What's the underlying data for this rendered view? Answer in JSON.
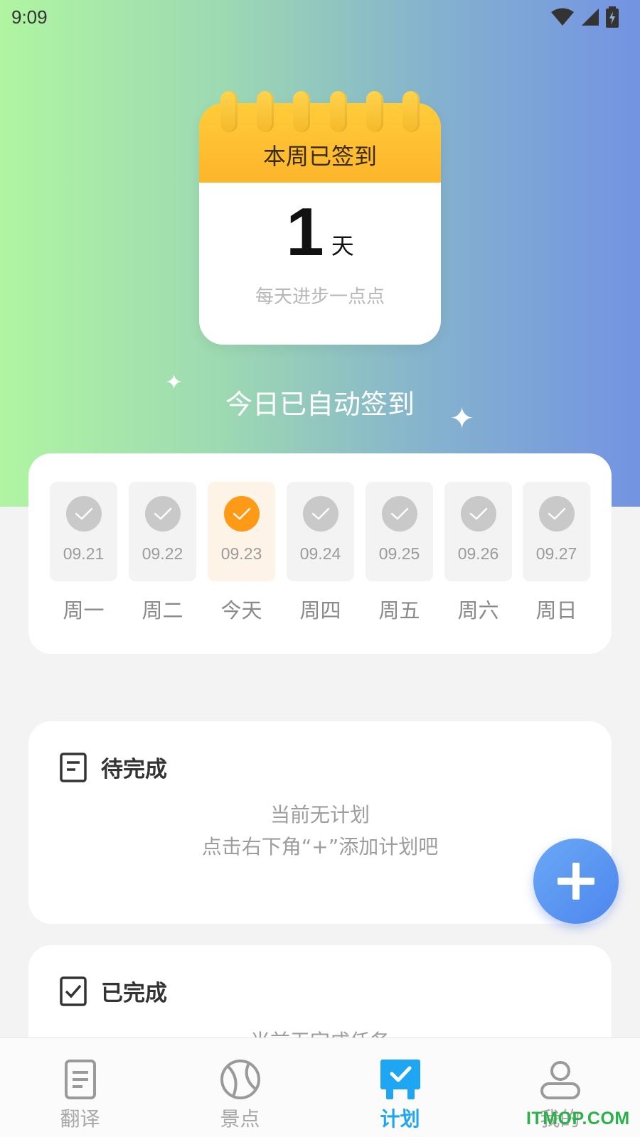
{
  "status_bar": {
    "time": "9:09"
  },
  "calendar": {
    "title": "本周已签到",
    "count": "1",
    "unit": "天",
    "subtitle": "每天进步一点点"
  },
  "auto_signed_text": "今日已自动签到",
  "week": {
    "days": [
      {
        "date": "09.21",
        "label": "周一",
        "checked": true,
        "today": false
      },
      {
        "date": "09.22",
        "label": "周二",
        "checked": true,
        "today": false
      },
      {
        "date": "09.23",
        "label": "今天",
        "checked": true,
        "today": true
      },
      {
        "date": "09.24",
        "label": "周四",
        "checked": true,
        "today": false
      },
      {
        "date": "09.25",
        "label": "周五",
        "checked": true,
        "today": false
      },
      {
        "date": "09.26",
        "label": "周六",
        "checked": true,
        "today": false
      },
      {
        "date": "09.27",
        "label": "周日",
        "checked": true,
        "today": false
      }
    ]
  },
  "pending": {
    "title": "待完成",
    "empty_line1": "当前无计划",
    "empty_line2": "点击右下角“+”添加计划吧"
  },
  "completed": {
    "title": "已完成",
    "empty_line1": "当前无完成任务"
  },
  "fab": {
    "icon": "plus-icon"
  },
  "bottom_nav": {
    "items": [
      {
        "label": "翻译",
        "icon": "document-icon",
        "active": false
      },
      {
        "label": "景点",
        "icon": "ball-icon",
        "active": false
      },
      {
        "label": "计划",
        "icon": "check-calendar-icon",
        "active": true
      },
      {
        "label": "我的",
        "icon": "person-icon",
        "active": false
      }
    ]
  },
  "watermark": "ITMOP.COM",
  "colors": {
    "accent_orange": "#ff9a16",
    "accent_blue": "#1fa6f2",
    "fab_blue": "#5a93f0",
    "calendar_yellow": "#fdb52a"
  }
}
